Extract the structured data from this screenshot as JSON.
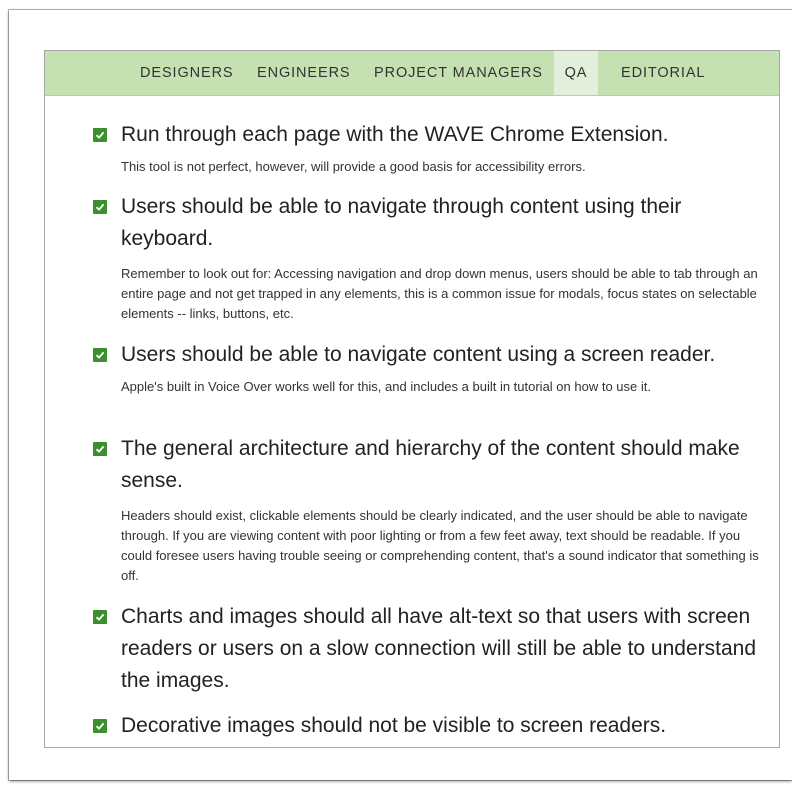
{
  "tabs": [
    {
      "label": "DESIGNERS",
      "active": false
    },
    {
      "label": "ENGINEERS",
      "active": false
    },
    {
      "label": "PROJECT MANAGERS",
      "active": false
    },
    {
      "label": "QA",
      "active": true
    },
    {
      "label": "EDITORIAL",
      "active": false
    }
  ],
  "colors": {
    "tab_bar": "#c5e1b2",
    "tab_active": "#e3efdb",
    "checkbox": "#3b8f2c"
  },
  "checklist": [
    {
      "title": "Run through each page with the WAVE Chrome Extension.",
      "checked": true,
      "description": "This tool is not perfect, however, will provide a good basis for accessibility errors."
    },
    {
      "title": "Users should be able to navigate through content using their keyboard.",
      "checked": true,
      "description": "Remember to look out for: Accessing navigation and drop down menus, users should be able to tab through an entire page and not get trapped in any elements, this is a common issue for modals, focus states on selectable elements -- links, buttons, etc."
    },
    {
      "title": "Users should be able to navigate content using a screen reader.",
      "checked": true,
      "description": "Apple's built in Voice Over works well for this, and includes a built in tutorial on how to use it."
    },
    {
      "title": "The general architecture and hierarchy of the content should make sense.",
      "checked": true,
      "description": "Headers should exist, clickable elements should be clearly indicated, and the user should be able to navigate through. If you are viewing content with poor lighting or from a few feet away, text should be readable. If you could foresee users having trouble seeing or comprehending content, that's a sound indicator that something is off."
    },
    {
      "title": "Charts and images should all have alt-text so that users with screen readers or users on a slow connection will still be able to understand the images.",
      "checked": true,
      "description": ""
    },
    {
      "title": "Decorative images should not be visible to screen readers.",
      "checked": true,
      "description": ""
    }
  ]
}
